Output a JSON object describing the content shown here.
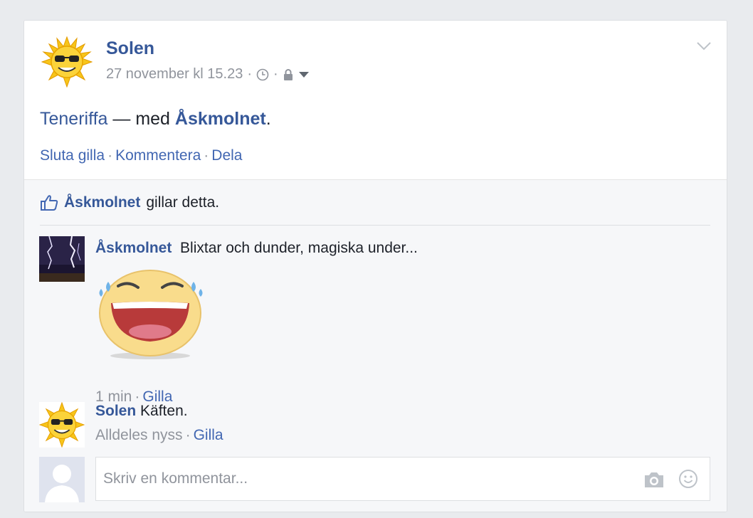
{
  "post": {
    "author": "Solen",
    "timestamp": "27 november kl 15.23",
    "meta_sep": "·",
    "text_place": "Teneriffa",
    "text_dash": " — med ",
    "text_tagged": "Åskmolnet",
    "text_end": ".",
    "actions": {
      "unlike": "Sluta gilla",
      "comment": "Kommentera",
      "share": "Dela",
      "sep": "·"
    }
  },
  "likes": {
    "name": "Åskmolnet",
    "text": "gillar detta."
  },
  "comments": [
    {
      "author": "Åskmolnet",
      "text": "Blixtar och dunder, magiska under...",
      "time": "1 min",
      "like": "Gilla",
      "sticker": "laughing-tears-sticker"
    },
    {
      "author": "Solen",
      "text": "Käften.",
      "time": "Alldeles nyss",
      "like": "Gilla"
    }
  ],
  "composer": {
    "placeholder": "Skriv en kommentar...",
    "icons": [
      "camera-icon",
      "smiley-icon"
    ]
  },
  "colors": {
    "link": "#365899",
    "action": "#4267b2",
    "muted": "#90949c",
    "background": "#e9ebee",
    "ufi": "#f6f7f9"
  }
}
